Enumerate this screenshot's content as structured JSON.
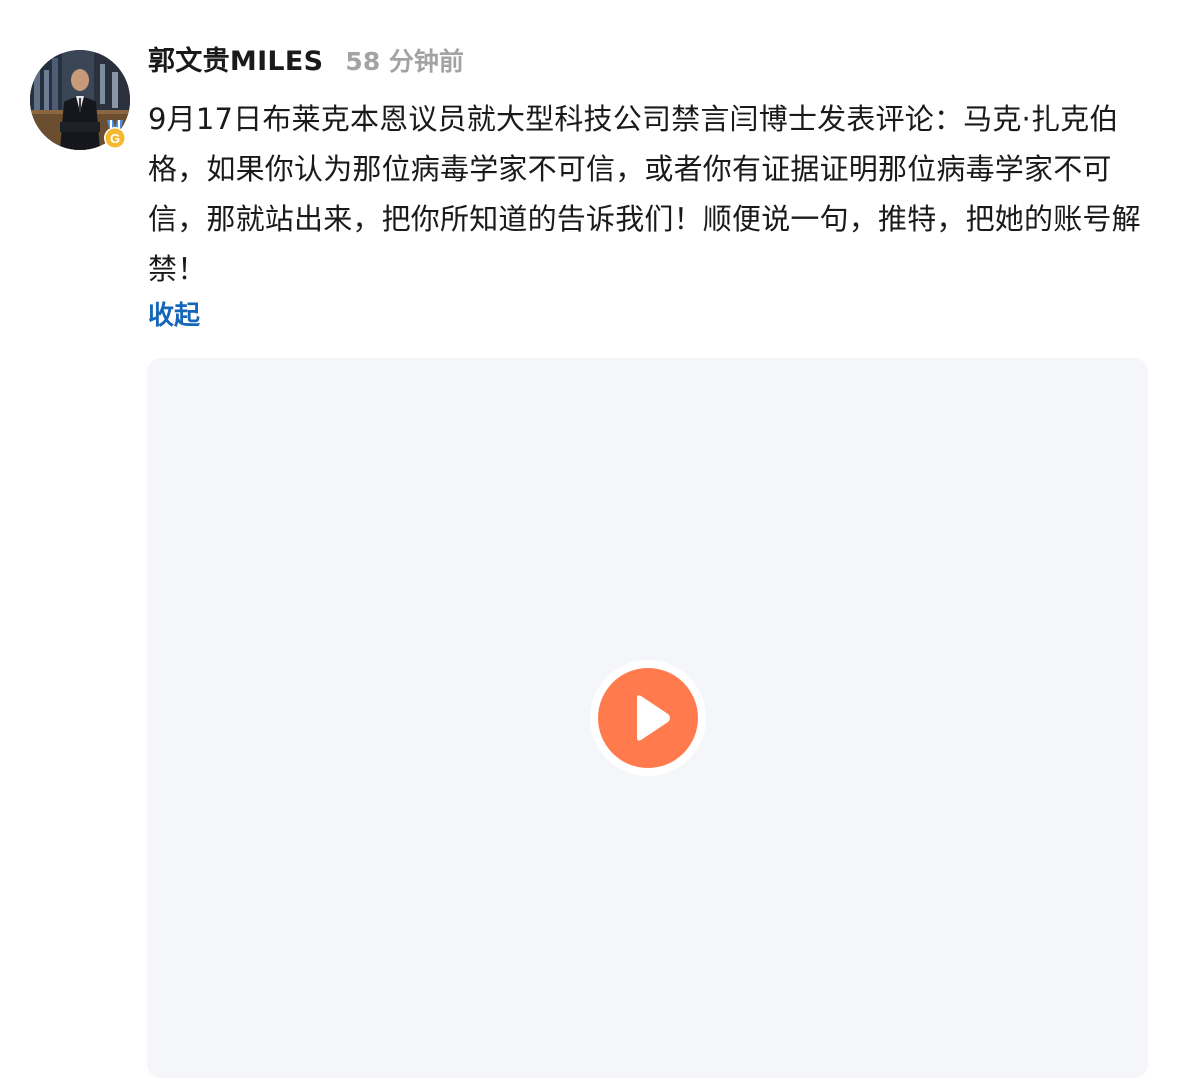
{
  "post": {
    "author": "郭文贵MILES",
    "time": "58 分钟前",
    "text": "9月17日布莱克本恩议员就大型科技公司禁言闫博士发表评论：马克·扎克伯格，如果你认为那位病毒学家不可信，或者你有证据证明那位病毒学家不可信，那就站出来，把你所知道的告诉我们！顺便说一句，推特，把她的账号解禁！",
    "collapse_label": "收起"
  },
  "icons": {
    "avatar": "user-avatar-photo",
    "badge": "gold-medal-badge-icon",
    "play": "play-icon"
  },
  "colors": {
    "link": "#1466b8",
    "play_button": "#ff7a4d",
    "video_bg": "#f4f6fa",
    "timestamp": "#a3a3a3",
    "badge_gold": "#f5b82e",
    "badge_blue": "#4d8fe0"
  }
}
